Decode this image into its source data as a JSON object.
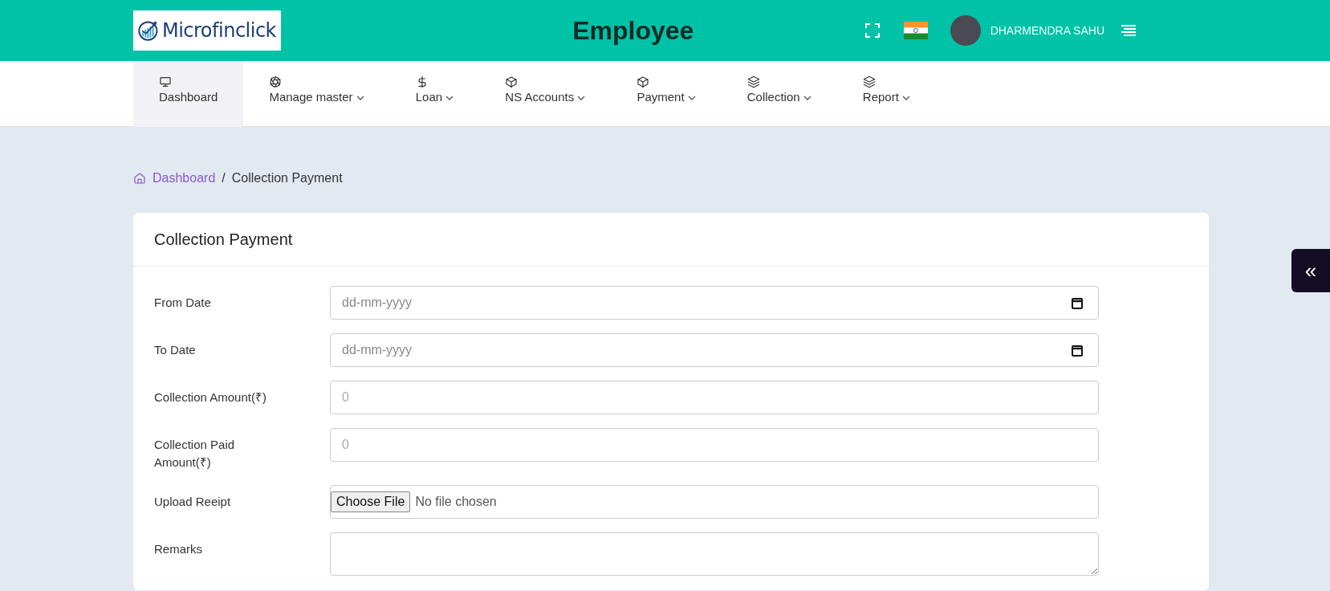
{
  "header": {
    "logo_text": "Microfinclick",
    "title": "Employee",
    "user_name": "DHARMENDRA SAHU"
  },
  "nav": [
    {
      "label": "Dashboard",
      "dropdown": false,
      "selected": true
    },
    {
      "label": "Manage master",
      "dropdown": true,
      "selected": false
    },
    {
      "label": "Loan",
      "dropdown": true,
      "selected": false
    },
    {
      "label": "NS Accounts",
      "dropdown": true,
      "selected": false
    },
    {
      "label": "Payment",
      "dropdown": true,
      "selected": false
    },
    {
      "label": "Collection",
      "dropdown": true,
      "selected": false
    },
    {
      "label": "Report",
      "dropdown": true,
      "selected": false
    }
  ],
  "breadcrumb": [
    {
      "label": "Dashboard",
      "link": true
    },
    {
      "label": "Collection Payment",
      "link": false
    }
  ],
  "breadcrumb_separator": "/",
  "card": {
    "title": "Collection Payment",
    "fields": [
      {
        "label": "From Date",
        "kind": "date",
        "placeholder": "dd-mm-yyyy"
      },
      {
        "label": "To Date",
        "kind": "date",
        "placeholder": "dd-mm-yyyy"
      },
      {
        "label": "Collection Amount(₹)",
        "kind": "number",
        "placeholder": "0"
      },
      {
        "label": "Collection Paid Amount(₹)",
        "kind": "number",
        "placeholder": "0"
      },
      {
        "label": "Upload Reeipt",
        "kind": "file",
        "button": "Choose File",
        "status": "No file chosen"
      },
      {
        "label": "Remarks",
        "kind": "textarea"
      }
    ]
  },
  "side_toggle": "«"
}
